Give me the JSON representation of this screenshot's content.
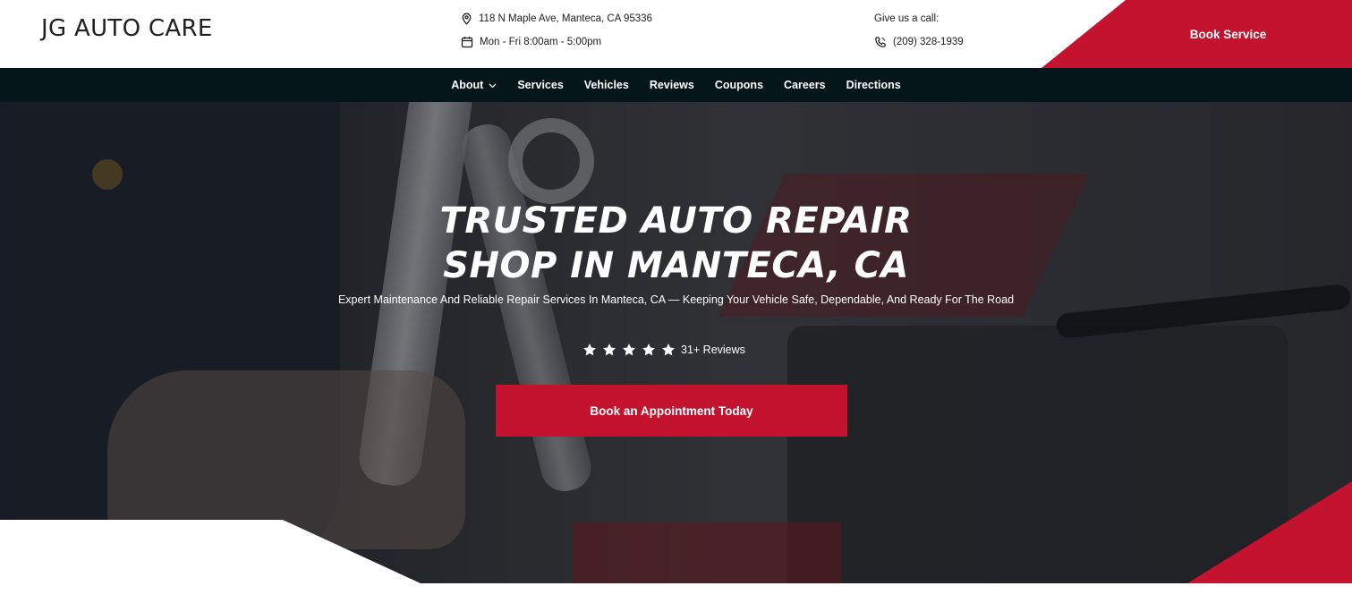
{
  "header": {
    "logo_text": "JG AUTO CARE",
    "address": "118 N Maple Ave, Manteca, CA 95336",
    "hours": "Mon - Fri 8:00am - 5:00pm",
    "call_label": "Give us a call:",
    "phone": "(209) 328-1939",
    "book_service_label": "Book Service"
  },
  "nav": {
    "items": [
      {
        "label": "About",
        "has_dropdown": true
      },
      {
        "label": "Services"
      },
      {
        "label": "Vehicles"
      },
      {
        "label": "Reviews"
      },
      {
        "label": "Coupons"
      },
      {
        "label": "Careers"
      },
      {
        "label": "Directions"
      }
    ]
  },
  "hero": {
    "title_line1": "TRUSTED AUTO REPAIR",
    "title_line2": "SHOP IN MANTECA, CA",
    "subtitle": "Expert Maintenance And Reliable Repair Services In Manteca, CA — Keeping Your Vehicle Safe, Dependable, And Ready For The Road",
    "rating_stars": 5,
    "reviews_label": "31+ Reviews",
    "cta_label": "Book an Appointment Today"
  },
  "colors": {
    "accent": "#c3132f",
    "nav_bg": "#05161b",
    "text_dark": "#1c1c1c"
  },
  "icons": [
    "map-pin-icon",
    "calendar-icon",
    "phone-icon",
    "chevron-down-icon",
    "star-icon"
  ]
}
